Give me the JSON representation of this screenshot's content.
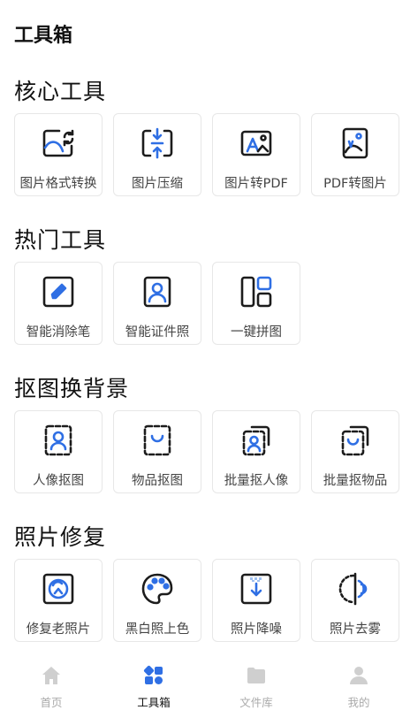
{
  "header": {
    "title": "工具箱"
  },
  "colors": {
    "accent": "#2f6fe4",
    "icon_dark": "#1c1c1c",
    "tab_inactive": "#cfcfcf"
  },
  "sections": [
    {
      "title": "核心工具",
      "tools": [
        {
          "label": "图片格式转换",
          "icon": "image-convert-icon"
        },
        {
          "label": "图片压缩",
          "icon": "image-compress-icon"
        },
        {
          "label": "图片转PDF",
          "icon": "image-to-pdf-icon"
        },
        {
          "label": "PDF转图片",
          "icon": "pdf-to-image-icon"
        }
      ]
    },
    {
      "title": "热门工具",
      "tools": [
        {
          "label": "智能消除笔",
          "icon": "eraser-pen-icon"
        },
        {
          "label": "智能证件照",
          "icon": "id-photo-icon"
        },
        {
          "label": "一键拼图",
          "icon": "collage-icon"
        }
      ]
    },
    {
      "title": "抠图换背景",
      "tools": [
        {
          "label": "人像抠图",
          "icon": "portrait-cutout-icon"
        },
        {
          "label": "物品抠图",
          "icon": "object-cutout-icon"
        },
        {
          "label": "批量抠人像",
          "icon": "batch-portrait-cutout-icon"
        },
        {
          "label": "批量抠物品",
          "icon": "batch-object-cutout-icon"
        }
      ]
    },
    {
      "title": "照片修复",
      "tools": [
        {
          "label": "修复老照片",
          "icon": "restore-photo-icon"
        },
        {
          "label": "黑白照上色",
          "icon": "palette-icon"
        },
        {
          "label": "照片降噪",
          "icon": "denoise-icon"
        },
        {
          "label": "照片去雾",
          "icon": "dehaze-icon"
        }
      ]
    }
  ],
  "tabbar": [
    {
      "label": "首页",
      "icon": "home-icon",
      "active": false
    },
    {
      "label": "工具箱",
      "icon": "toolbox-icon",
      "active": true
    },
    {
      "label": "文件库",
      "icon": "folder-icon",
      "active": false
    },
    {
      "label": "我的",
      "icon": "user-icon",
      "active": false
    }
  ]
}
